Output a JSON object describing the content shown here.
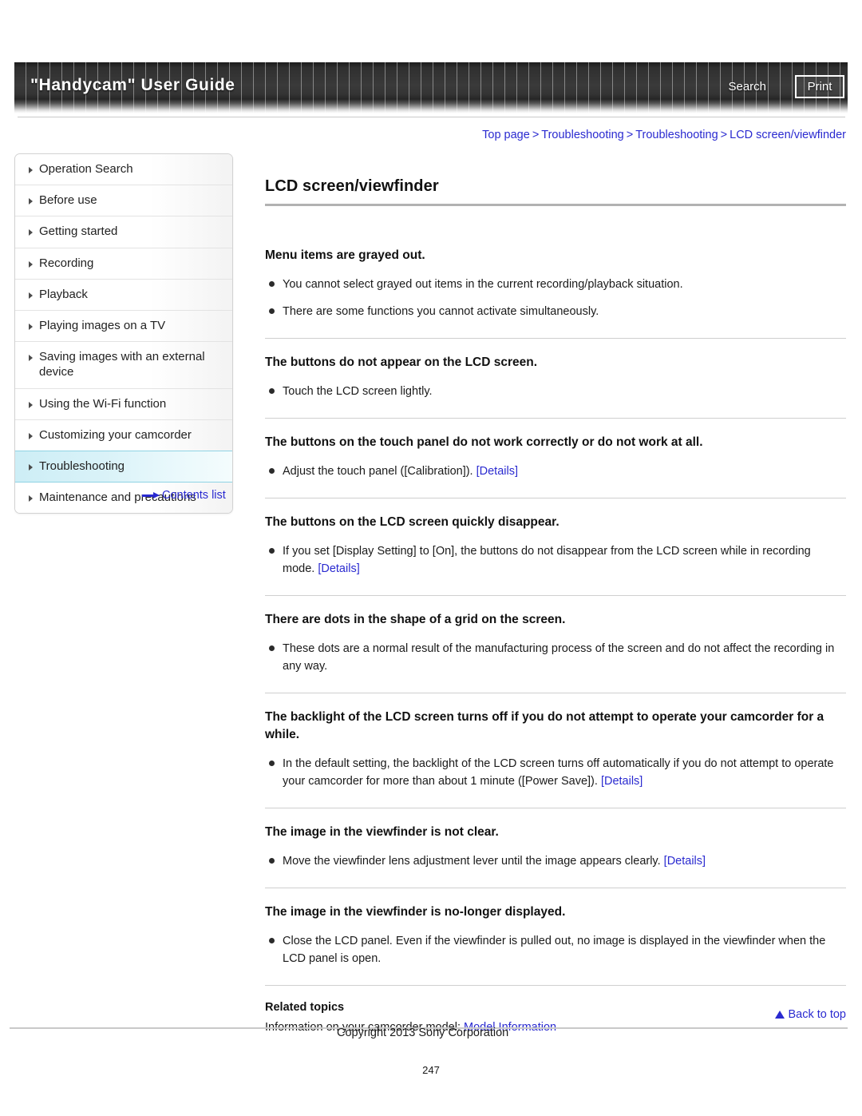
{
  "header": {
    "title": "\"Handycam\" User Guide",
    "search_label": "Search",
    "print_label": "Print"
  },
  "breadcrumb": {
    "items": [
      "Top page",
      "Troubleshooting",
      "Troubleshooting",
      "LCD screen/viewfinder"
    ],
    "separator": ">"
  },
  "sidebar": {
    "items": [
      {
        "label": "Operation Search",
        "active": false
      },
      {
        "label": "Before use",
        "active": false
      },
      {
        "label": "Getting started",
        "active": false
      },
      {
        "label": "Recording",
        "active": false
      },
      {
        "label": "Playback",
        "active": false
      },
      {
        "label": "Playing images on a TV",
        "active": false
      },
      {
        "label": "Saving images with an external device",
        "active": false
      },
      {
        "label": "Using the Wi-Fi function",
        "active": false
      },
      {
        "label": "Customizing your camcorder",
        "active": false
      },
      {
        "label": "Troubleshooting",
        "active": true
      },
      {
        "label": "Maintenance and precautions",
        "active": false
      }
    ],
    "contents_list_label": "Contents list"
  },
  "main": {
    "page_title": "LCD screen/viewfinder",
    "sections": [
      {
        "heading": "Menu items are grayed out.",
        "bullets": [
          {
            "text": "You cannot select grayed out items in the current recording/playback situation.",
            "link": ""
          },
          {
            "text": "There are some functions you cannot activate simultaneously.",
            "link": ""
          }
        ]
      },
      {
        "heading": "The buttons do not appear on the LCD screen.",
        "bullets": [
          {
            "text": "Touch the LCD screen lightly.",
            "link": ""
          }
        ]
      },
      {
        "heading": "The buttons on the touch panel do not work correctly or do not work at all.",
        "bullets": [
          {
            "text": "Adjust the touch panel ([Calibration]). ",
            "link": "[Details]"
          }
        ]
      },
      {
        "heading": "The buttons on the LCD screen quickly disappear.",
        "bullets": [
          {
            "text": "If you set [Display Setting] to [On], the buttons do not disappear from the LCD screen while in recording mode. ",
            "link": "[Details]"
          }
        ]
      },
      {
        "heading": "There are dots in the shape of a grid on the screen.",
        "bullets": [
          {
            "text": "These dots are a normal result of the manufacturing process of the screen and do not affect the recording in any way.",
            "link": ""
          }
        ]
      },
      {
        "heading": "The backlight of the LCD screen turns off if you do not attempt to operate your camcorder for a while.",
        "bullets": [
          {
            "text": "In the default setting, the backlight of the LCD screen turns off automatically if you do not attempt to operate your camcorder for more than about 1 minute ([Power Save]). ",
            "link": "[Details]"
          }
        ]
      },
      {
        "heading": "The image in the viewfinder is not clear.",
        "bullets": [
          {
            "text": "Move the viewfinder lens adjustment lever until the image appears clearly. ",
            "link": "[Details]"
          }
        ]
      },
      {
        "heading": "The image in the viewfinder is no-longer displayed.",
        "bullets": [
          {
            "text": "Close the LCD panel. Even if the viewfinder is pulled out, no image is displayed in the viewfinder when the LCD panel is open.",
            "link": ""
          }
        ]
      }
    ],
    "related": {
      "heading": "Related topics",
      "text_prefix": "Information on your camcorder model: ",
      "link_label": "Model Information"
    }
  },
  "footer": {
    "back_to_top_label": "Back to top",
    "copyright": "Copyright 2013 Sony Corporation",
    "page_number": "247"
  },
  "colors": {
    "link": "#2a2ad0",
    "active_nav": "#cdeef6",
    "banner_dark": "#2f2f2f"
  }
}
